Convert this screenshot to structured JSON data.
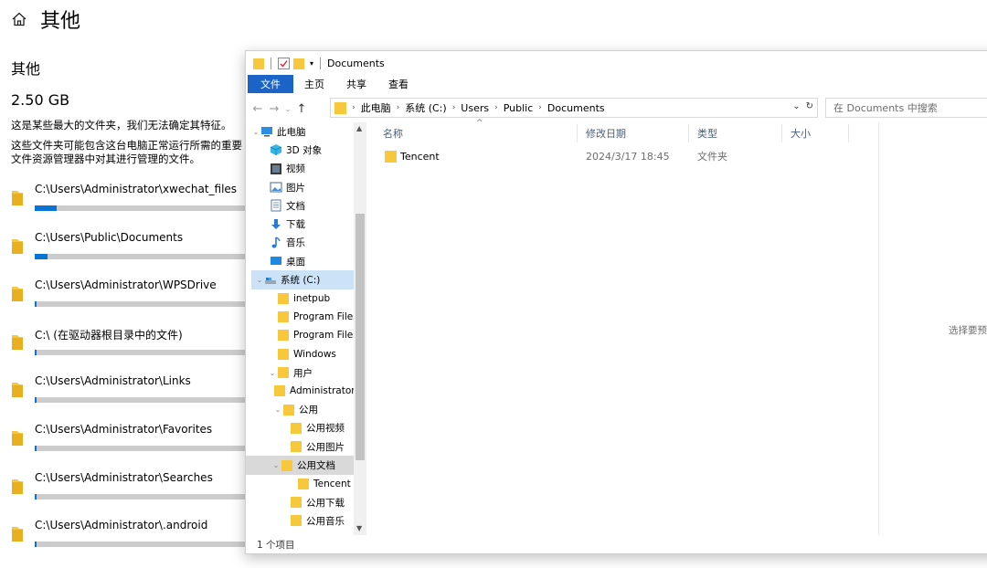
{
  "settings": {
    "page_title": "其他",
    "section_title": "其他",
    "size": "2.50 GB",
    "desc1": "这是某些最大的文件夹，我们无法确定其特征。",
    "desc2_line1": "这些文件夹可能包含这台电脑正常运行所需的重要",
    "desc2_line2": "文件资源管理器中对其进行管理的文件。",
    "folders": [
      {
        "path": "C:\\Users\\Administrator\\xwechat_files",
        "fraction": 0.1
      },
      {
        "path": "C:\\Users\\Public\\Documents",
        "fraction": 0.06
      },
      {
        "path": "C:\\Users\\Administrator\\WPSDrive",
        "fraction": 0.01
      },
      {
        "path": "C:\\ (在驱动器根目录中的文件)",
        "fraction": 0.01
      },
      {
        "path": "C:\\Users\\Administrator\\Links",
        "fraction": 0.01
      },
      {
        "path": "C:\\Users\\Administrator\\Favorites",
        "fraction": 0.01
      },
      {
        "path": "C:\\Users\\Administrator\\Searches",
        "fraction": 0.01
      },
      {
        "path": "C:\\Users\\Administrator\\.android",
        "fraction": 0.01
      }
    ]
  },
  "explorer": {
    "title": "Documents",
    "ribbon_tabs": [
      "文件",
      "主页",
      "共享",
      "查看"
    ],
    "breadcrumb": [
      "此电脑",
      "系统 (C:)",
      "Users",
      "Public",
      "Documents"
    ],
    "search_placeholder": "在 Documents 中搜索",
    "tree": [
      {
        "label": "此电脑",
        "icon": "pc-icon"
      },
      {
        "label": "3D 对象",
        "icon": "3d-objects-icon"
      },
      {
        "label": "视频",
        "icon": "video-icon"
      },
      {
        "label": "图片",
        "icon": "pictures-icon"
      },
      {
        "label": "文档",
        "icon": "document-icon"
      },
      {
        "label": "下载",
        "icon": "download-icon"
      },
      {
        "label": "音乐",
        "icon": "music-icon"
      },
      {
        "label": "桌面",
        "icon": "desktop-icon"
      },
      {
        "label": "系统 (C:)",
        "icon": "drive-icon"
      },
      {
        "label": "inetpub",
        "icon": "folder-icon"
      },
      {
        "label": "Program Files",
        "icon": "folder-icon"
      },
      {
        "label": "Program Files",
        "icon": "folder-icon"
      },
      {
        "label": "Windows",
        "icon": "folder-icon"
      },
      {
        "label": "用户",
        "icon": "folder-icon"
      },
      {
        "label": "Administrator",
        "icon": "folder-icon"
      },
      {
        "label": "公用",
        "icon": "folder-icon"
      },
      {
        "label": "公用视频",
        "icon": "folder-icon"
      },
      {
        "label": "公用图片",
        "icon": "folder-icon"
      },
      {
        "label": "公用文档",
        "icon": "folder-icon"
      },
      {
        "label": "Tencent",
        "icon": "folder-icon"
      },
      {
        "label": "公用下载",
        "icon": "folder-icon"
      },
      {
        "label": "公用音乐",
        "icon": "folder-icon"
      }
    ],
    "columns": {
      "name": "名称",
      "date": "修改日期",
      "type": "类型",
      "size": "大小"
    },
    "files": [
      {
        "name": "Tencent",
        "date": "2024/3/17 18:45",
        "type": "文件夹",
        "size": ""
      }
    ],
    "preview_text": "选择要预览",
    "status": "1 个项目"
  },
  "colors": {
    "accent": "#1a64c8",
    "bar_fill": "#0a74d4",
    "bar_track": "#cccccc",
    "folder": "#f8c83c"
  }
}
